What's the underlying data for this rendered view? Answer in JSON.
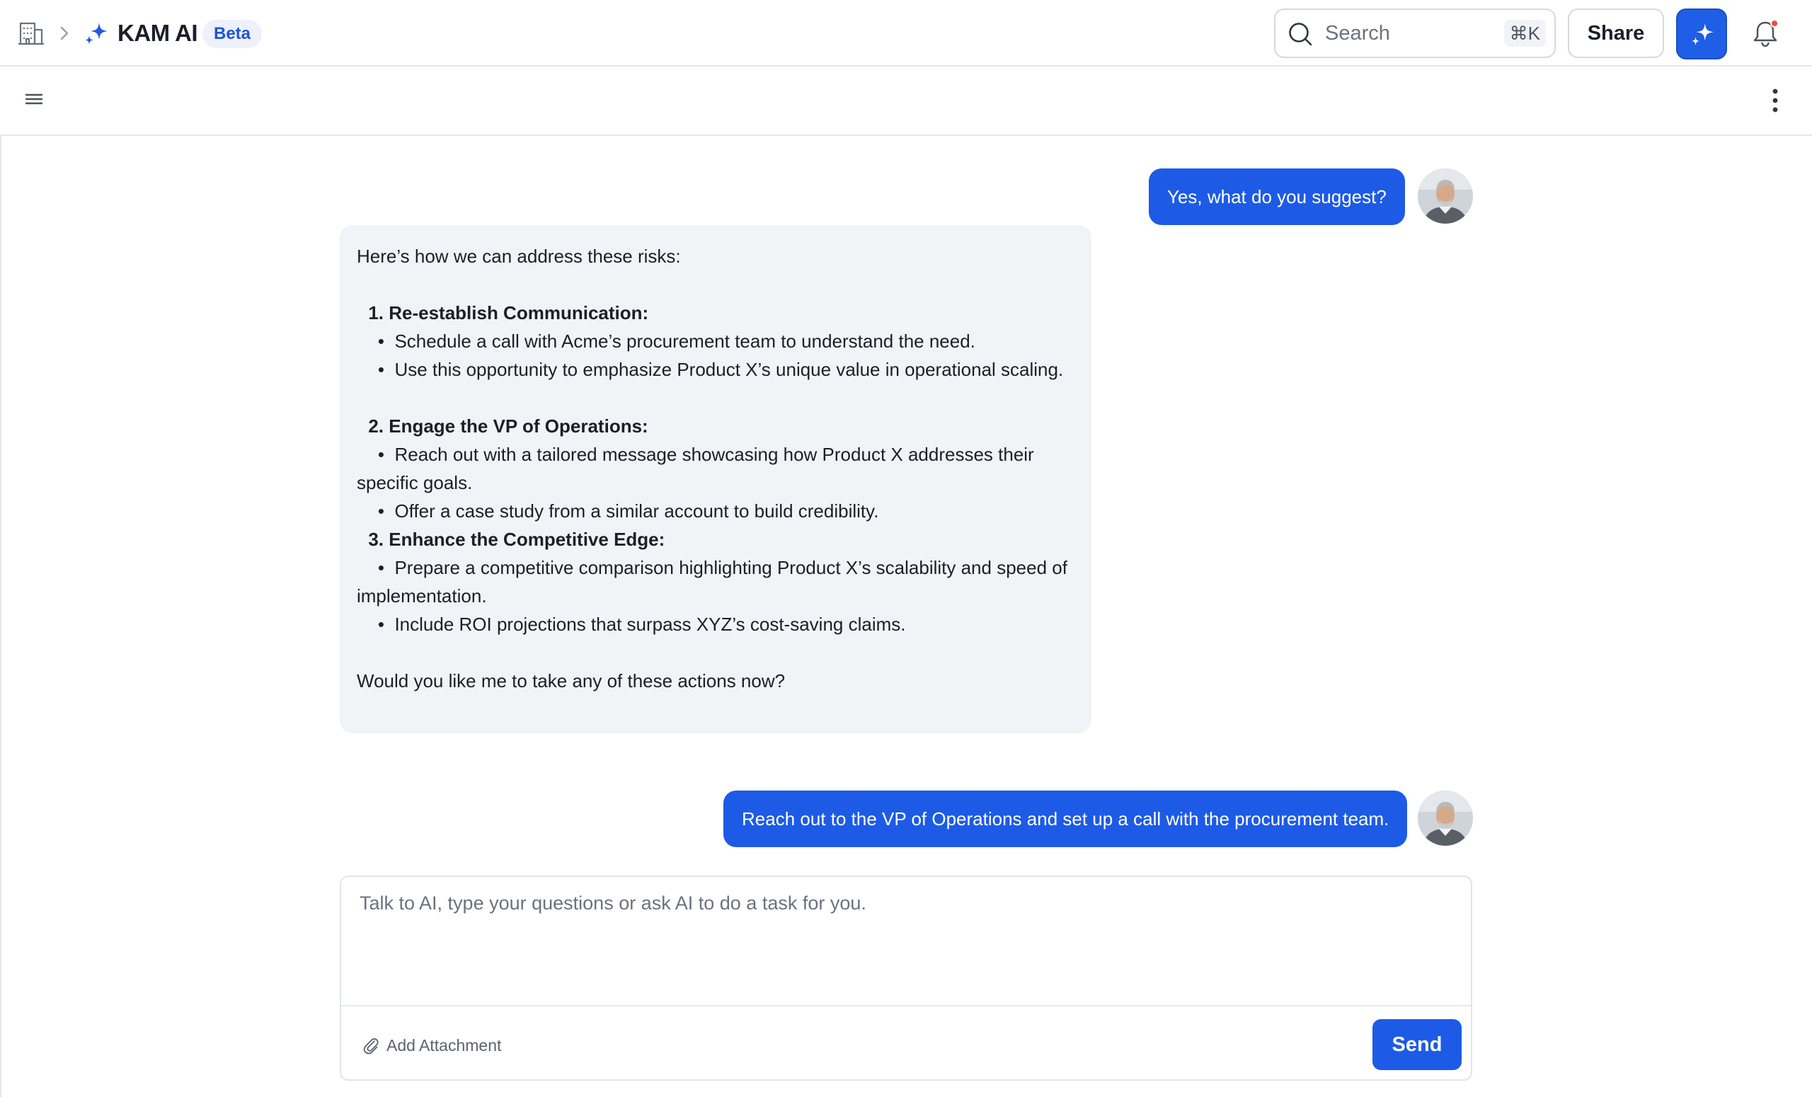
{
  "header": {
    "breadcrumb_icon": "building-icon",
    "separator_icon": "chevron-right-icon",
    "app_icon": "sparkle-icon",
    "app_title": "KAM AI",
    "badge": "Beta",
    "search": {
      "placeholder": "Search",
      "shortcut": "⌘K"
    },
    "share_label": "Share",
    "ai_button_icon": "sparkle-icon",
    "notifications_icon": "bell-icon"
  },
  "toolbar": {
    "menu_icon": "hamburger-menu-icon",
    "more_icon": "more-vertical-icon"
  },
  "conversation": {
    "messages": [
      {
        "role": "user",
        "text": "Yes, what do you suggest?"
      },
      {
        "role": "assistant",
        "intro": "Here’s how we can address these risks:",
        "steps": [
          {
            "number": "1.",
            "title": "Re-establish Communication:",
            "bullets": [
              "Schedule a call with Acme’s procurement team to understand the need.",
              "Use this opportunity to emphasize Product X’s unique value in operational scaling."
            ]
          },
          {
            "number": "2.",
            "title": "Engage the VP of Operations:",
            "bullets": [
              "Reach out with a tailored message showcasing how Product X addresses their specific goals.",
              "Offer a case study from a similar account to build credibility."
            ]
          },
          {
            "number": "3.",
            "title": "Enhance the Competitive Edge:",
            "bullets": [
              "Prepare a competitive comparison highlighting Product X’s scalability and speed of implementation.",
              "Include ROI projections that surpass XYZ’s cost-saving claims."
            ]
          }
        ],
        "closing": "Would you like me to take any of these actions now?"
      },
      {
        "role": "user",
        "text": "Reach out to the VP of Operations and set up a call with the procurement team."
      }
    ]
  },
  "composer": {
    "placeholder": "Talk to AI, type your questions or ask AI to do a task for you.",
    "attach_label": "Add Attachment",
    "send_label": "Send"
  },
  "colors": {
    "accent": "#1d5be6",
    "assistant_bubble": "#f2f3f6",
    "border": "#e6e8ec"
  }
}
